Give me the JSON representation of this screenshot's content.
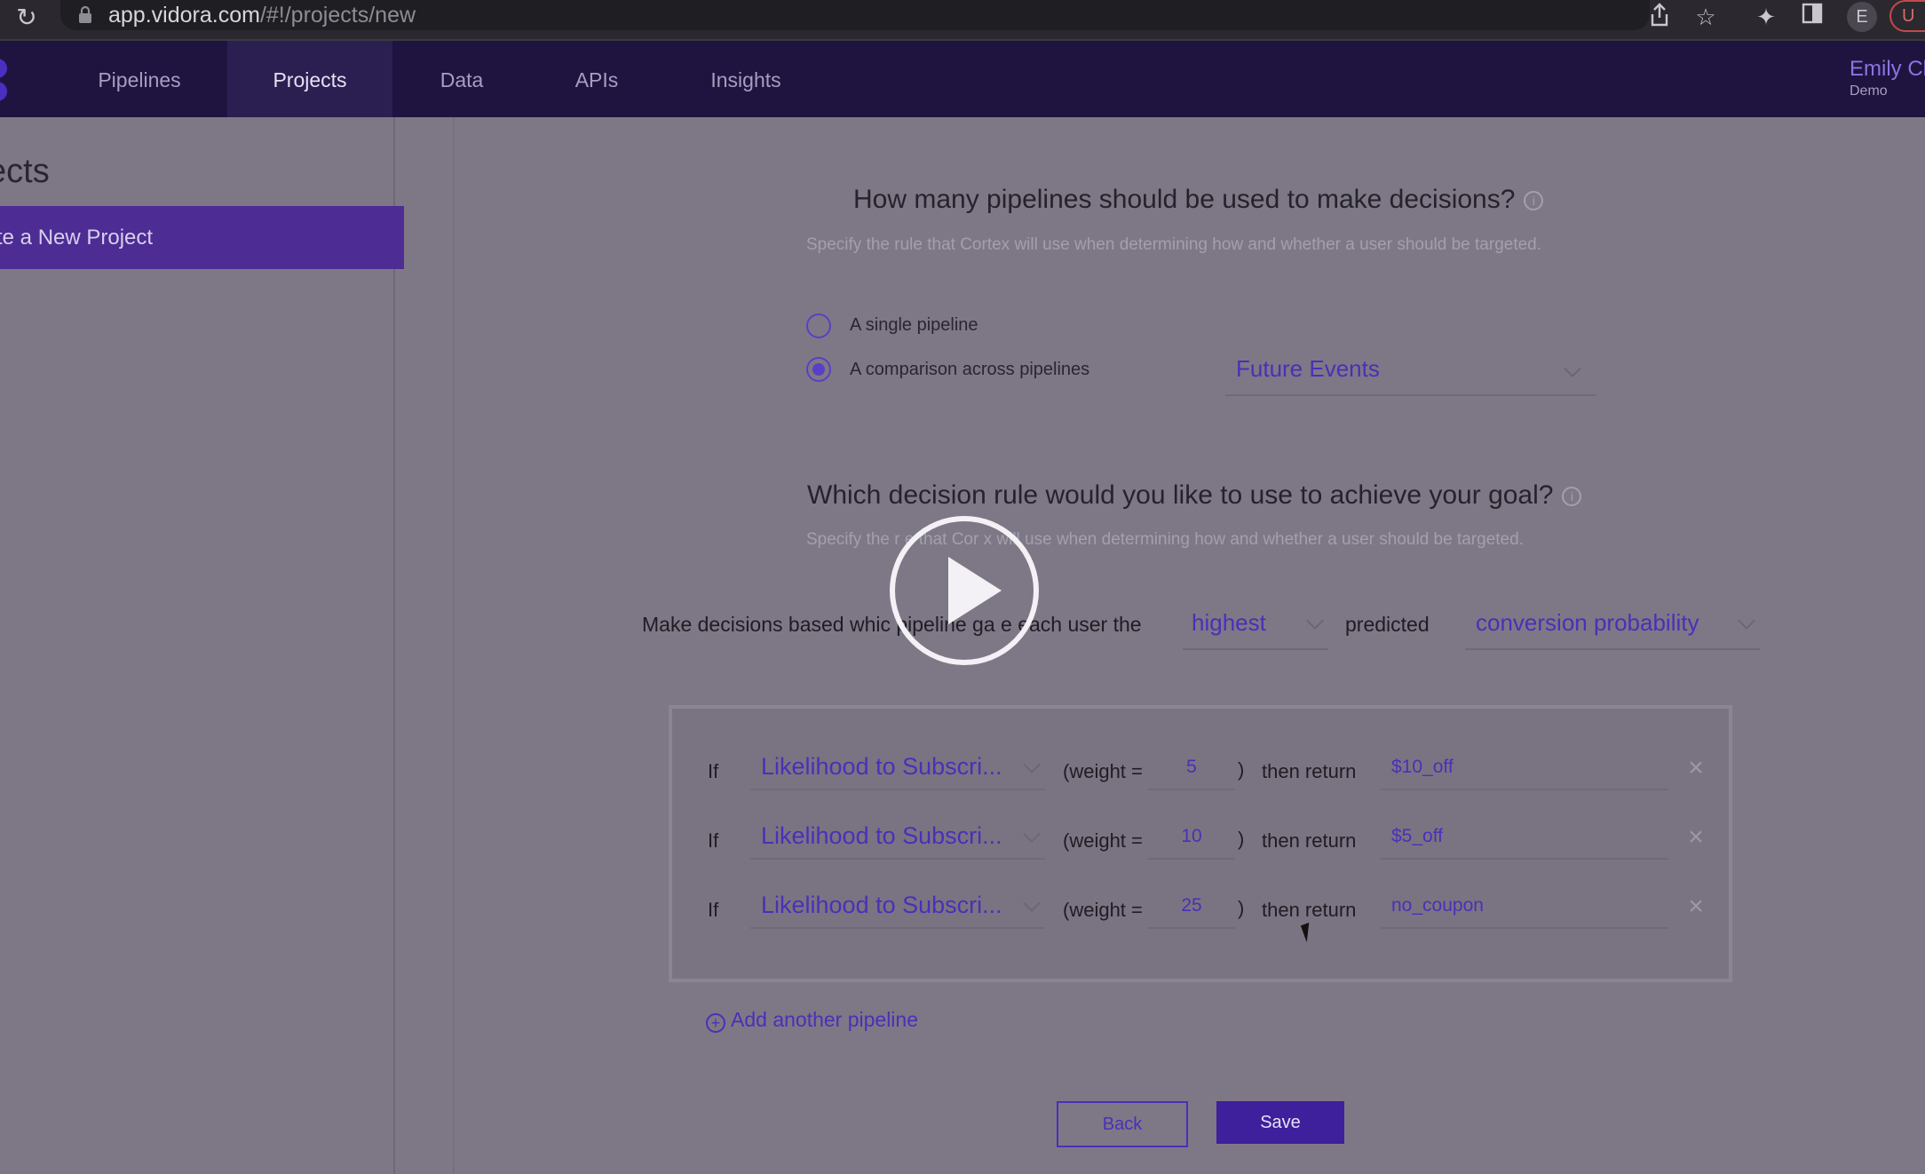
{
  "browser": {
    "url_host": "app.vidora.com",
    "url_path": "/#!/projects/new",
    "profile_initial": "E",
    "update_label": "U"
  },
  "nav": {
    "items": [
      "Pipelines",
      "Projects",
      "Data",
      "APIs",
      "Insights"
    ],
    "active": "Projects",
    "user_name": "Emily Cl",
    "user_role": "Demo"
  },
  "sidebar": {
    "title": "ects",
    "new_project_label": "te a New Project"
  },
  "section1": {
    "question": "How many pipelines should be used to make decisions?",
    "subtitle": "Specify the rule that Cortex will use when determining how and whether a user should be targeted.",
    "options": [
      {
        "label": "A single pipeline",
        "checked": false
      },
      {
        "label": "A comparison across pipelines",
        "checked": true
      }
    ],
    "dropdown_value": "Future Events"
  },
  "section2": {
    "question": "Which decision rule would you like to use to achieve your goal?",
    "subtitle": "Specify the r   e that Cor  x will use when determining how and whether a user should be targeted.",
    "sentence_prefix": "Make decisions based whic  pipeline ga  e each user the",
    "rank_value": "highest",
    "sentence_mid": "predicted",
    "metric_value": "conversion probability"
  },
  "rules": [
    {
      "if": "If",
      "pipeline": "Likelihood to Subscri...",
      "weight_label": "(weight =",
      "weight": "5",
      "paren": ")",
      "then": "then return",
      "return_value": "$10_off"
    },
    {
      "if": "If",
      "pipeline": "Likelihood to Subscri...",
      "weight_label": "(weight =",
      "weight": "10",
      "paren": ")",
      "then": "then return",
      "return_value": "$5_off"
    },
    {
      "if": "If",
      "pipeline": "Likelihood to Subscri...",
      "weight_label": "(weight =",
      "weight": "25",
      "paren": ")",
      "then": "then return",
      "return_value": "no_coupon"
    }
  ],
  "add_pipeline_label": "Add another pipeline",
  "buttons": {
    "back": "Back",
    "save": "Save"
  },
  "icons": {
    "reload": "reload-icon",
    "lock": "lock-icon",
    "share": "share-icon",
    "star": "star-icon",
    "extensions": "puzzle-icon",
    "sidepanel": "side-panel-icon",
    "info": "info-icon",
    "chevron": "chevron-down-icon",
    "close": "close-icon",
    "play": "play-icon"
  },
  "colors": {
    "accent": "#4b2fb8",
    "nav_bg": "#1f1440",
    "overlay_bg": "#7e7886"
  }
}
